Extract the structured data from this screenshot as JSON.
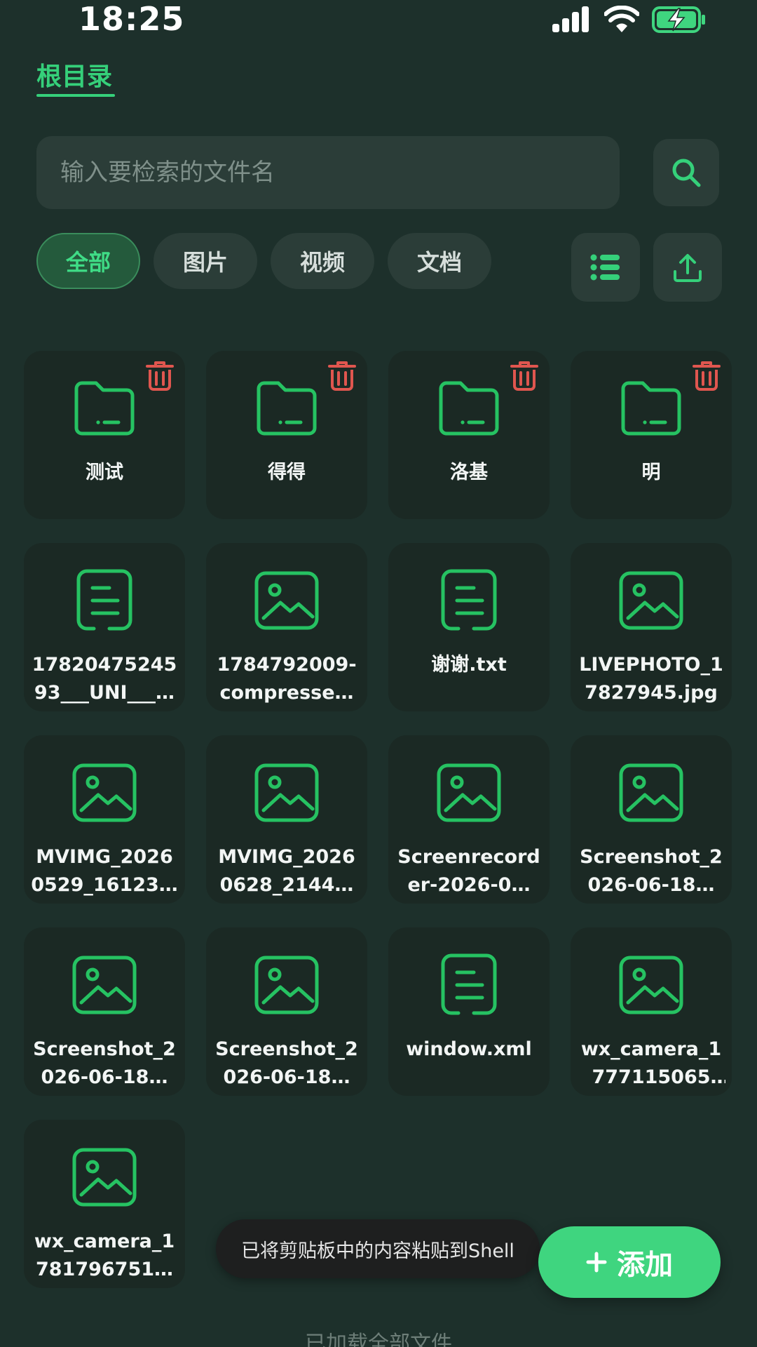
{
  "status_bar": {
    "time": "18:25"
  },
  "breadcrumb": {
    "label": "根目录"
  },
  "search": {
    "placeholder": "输入要检索的文件名"
  },
  "filters": [
    {
      "label": "全部",
      "active": true
    },
    {
      "label": "图片",
      "active": false
    },
    {
      "label": "视频",
      "active": false
    },
    {
      "label": "文档",
      "active": false
    }
  ],
  "files": [
    {
      "name": "测试",
      "type": "folder"
    },
    {
      "name": "得得",
      "type": "folder"
    },
    {
      "name": "洛基",
      "type": "folder"
    },
    {
      "name": "明",
      "type": "folder"
    },
    {
      "name": "1782047524593___UNI___…",
      "type": "document"
    },
    {
      "name": "1784792009-compresse…",
      "type": "image"
    },
    {
      "name": "谢谢.txt",
      "type": "document"
    },
    {
      "name": "LIVEPHOTO_17827945.jpg",
      "type": "image"
    },
    {
      "name": "MVIMG_20260529_16123…",
      "type": "image"
    },
    {
      "name": "MVIMG_20260628_2144…",
      "type": "image"
    },
    {
      "name": "Screenrecorder-2026-0…",
      "type": "image"
    },
    {
      "name": "Screenshot_2026-06-18…",
      "type": "image"
    },
    {
      "name": "Screenshot_2026-06-18…",
      "type": "image"
    },
    {
      "name": "Screenshot_2026-06-18…",
      "type": "image"
    },
    {
      "name": "window.xml",
      "type": "document"
    },
    {
      "name": "wx_camera_17771150651…",
      "type": "image"
    },
    {
      "name": "wx_camera_1781796751…",
      "type": "image"
    }
  ],
  "toast": {
    "text": "已将剪贴板中的内容粘贴到Shell"
  },
  "add_button": {
    "label": "添加"
  },
  "footer": {
    "text": "已加载全部文件"
  },
  "colors": {
    "accent": "#35d07a",
    "delete": "#e0564f",
    "background": "#1d302b",
    "card": "#1b2924"
  }
}
